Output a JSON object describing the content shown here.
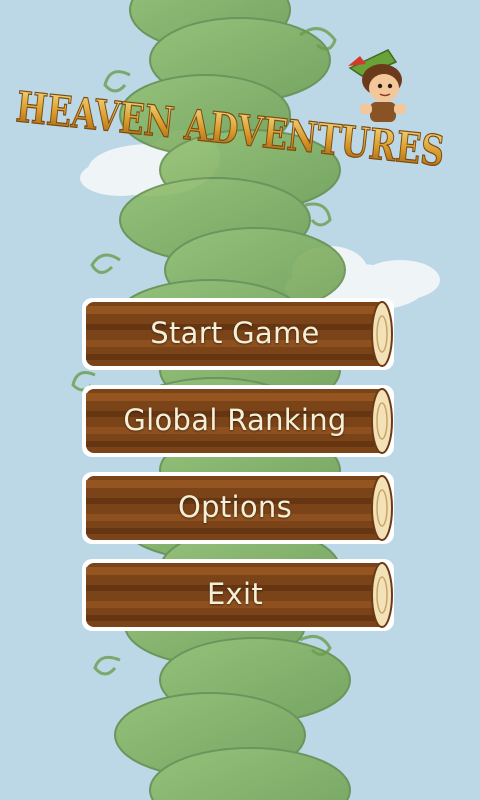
{
  "game": {
    "title": "HEAVEN ADVENTURES"
  },
  "menu": {
    "items": [
      {
        "label": "Start Game"
      },
      {
        "label": "Global Ranking"
      },
      {
        "label": "Options"
      },
      {
        "label": "Exit"
      }
    ]
  },
  "colors": {
    "sky": "#bcd7e6",
    "beanstalk": "#7fae5c",
    "log_wood": "#7a4318",
    "menu_text": "#f5efd8",
    "title_gold": "#c98a1c"
  },
  "icons": {
    "hero": "adventurer-character",
    "clouds": "cloud"
  }
}
